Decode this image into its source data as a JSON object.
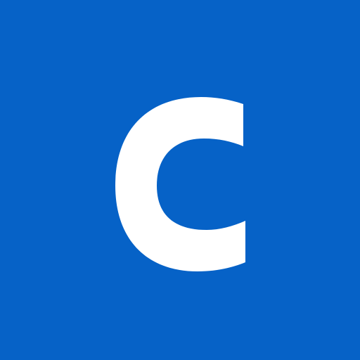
{
  "app_icon": {
    "letter": "c",
    "background_color": "#0662C7",
    "glyph_color": "#FFFFFF"
  }
}
